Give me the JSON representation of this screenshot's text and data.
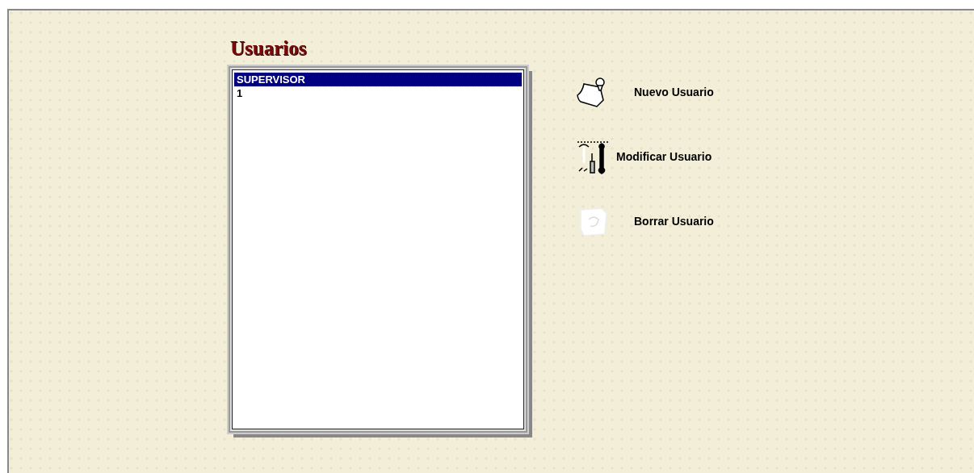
{
  "title": "Usuarios",
  "users": [
    {
      "name": "SUPERVISOR",
      "selected": true
    },
    {
      "name": "1",
      "selected": false
    }
  ],
  "actions": [
    {
      "kind": "note",
      "label": "Nuevo Usuario"
    },
    {
      "kind": "tools",
      "label": "Modificar Usuario"
    },
    {
      "kind": "trash",
      "label": "Borrar Usuario"
    }
  ]
}
